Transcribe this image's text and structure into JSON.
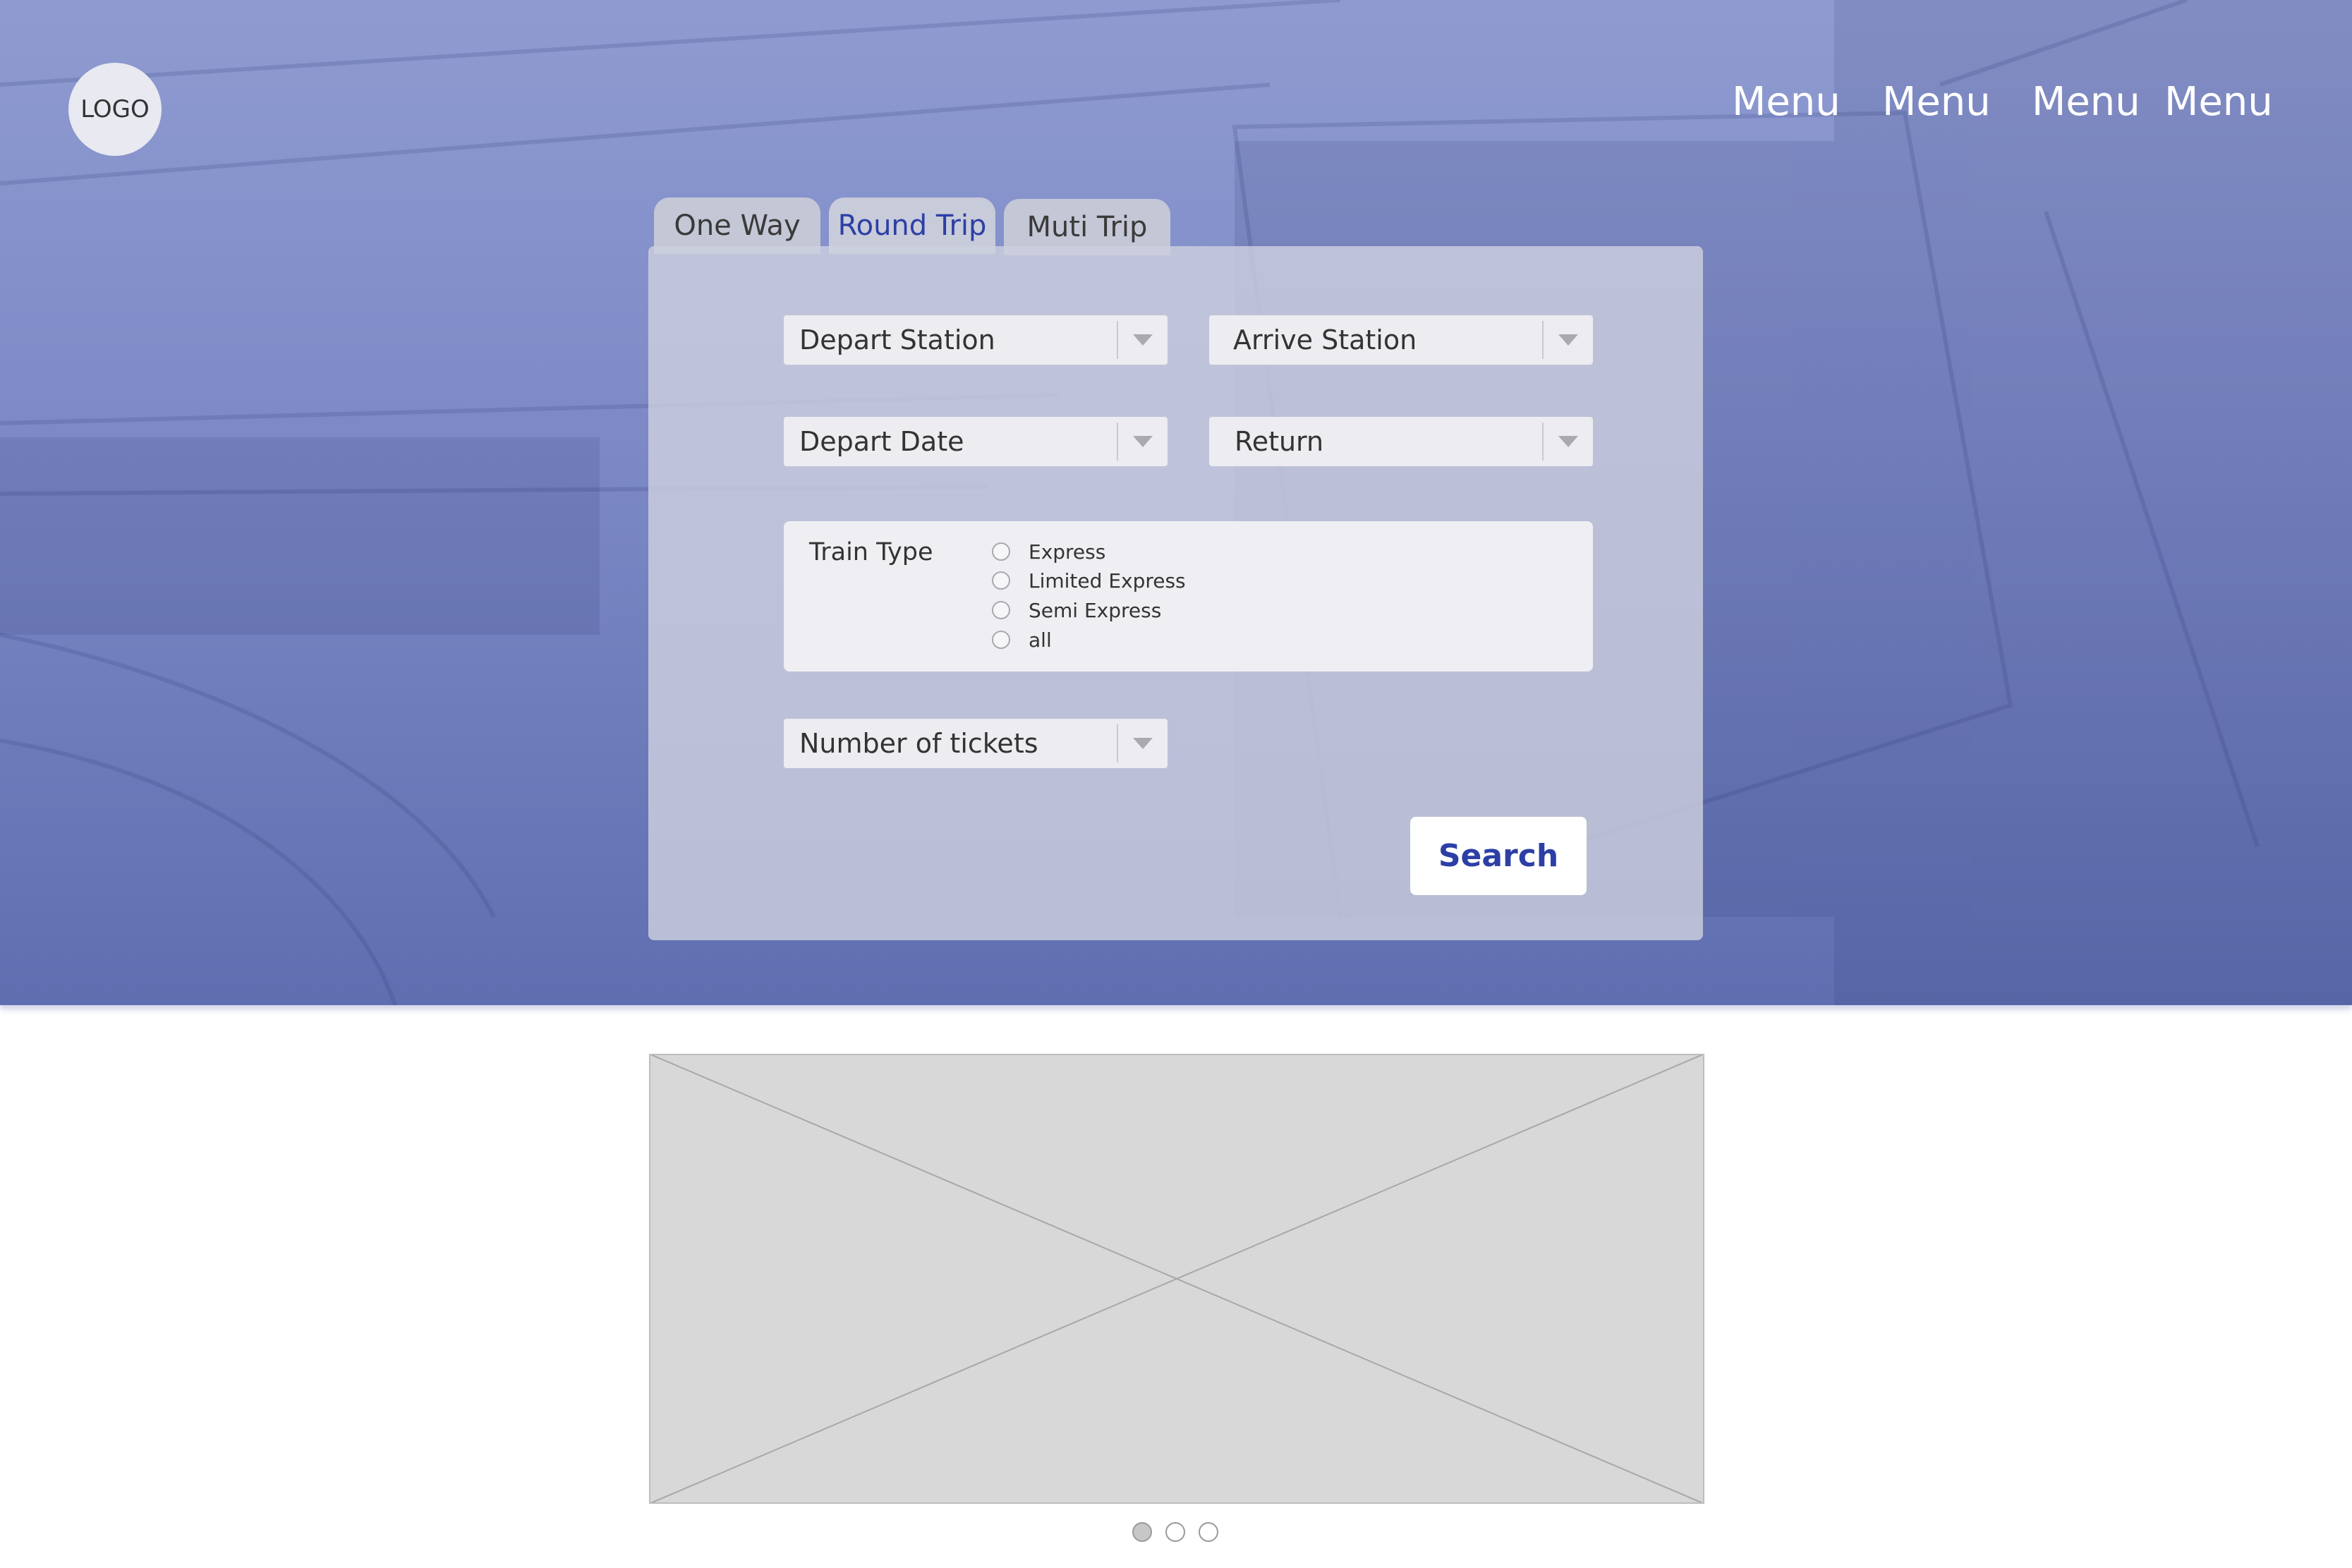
{
  "header": {
    "logo_text": "LOGO",
    "menu": [
      "Menu",
      "Menu",
      "Menu",
      "Menu"
    ]
  },
  "tabs": [
    {
      "label": "One Way",
      "active": false
    },
    {
      "label": "Round Trip",
      "active": true
    },
    {
      "label": "Muti Trip",
      "active": false
    }
  ],
  "form": {
    "depart_station": "Depart Station",
    "arrive_station": "Arrive Station",
    "depart_date": "Depart Date",
    "return": "Return",
    "train_type_label": "Train Type",
    "train_types": [
      "Express",
      "Limited Express",
      "Semi Express",
      "all"
    ],
    "tickets": "Number of tickets",
    "search_label": "Search"
  },
  "carousel": {
    "page_count": 3,
    "active_page": 1
  },
  "colors": {
    "accent": "#2c3fa6",
    "hero_overlay": "#7c89c6",
    "placeholder": "#d8d8d8"
  }
}
